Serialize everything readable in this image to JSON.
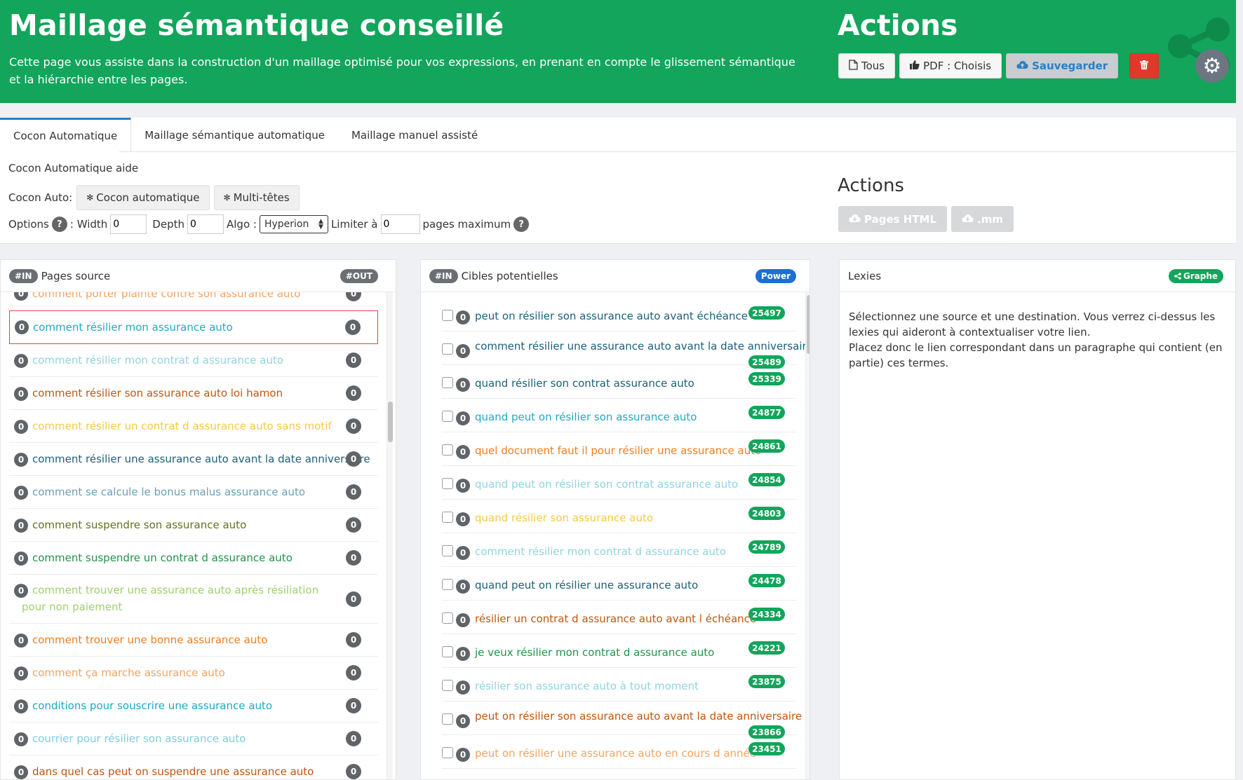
{
  "header": {
    "title": "Maillage sémantique conseillé",
    "description": "Cette page vous assiste dans la construction d'un maillage optimisé pour vos expressions, en prenant en compte le glissement sémantique et la hiérarchie entre les pages.",
    "actions_title": "Actions",
    "btn_tous": "Tous",
    "btn_pdf": "PDF : Choisis",
    "btn_save": "Sauvegarder",
    "colors": {
      "bg": "#12a55b",
      "delete": "#e0392c"
    }
  },
  "tabs": [
    {
      "label": "Cocon Automatique"
    },
    {
      "label": "Maillage sémantique automatique"
    },
    {
      "label": "Maillage manuel assisté"
    }
  ],
  "cocon": {
    "help_title": "Cocon Automatique aide",
    "label": "Cocon Auto:",
    "btn_auto": "Cocon automatique",
    "btn_multi": "Multi-têtes",
    "options_label": "Options",
    "width_label": ": Width",
    "width_value": "0",
    "depth_label": "Depth",
    "depth_value": "0",
    "algo_label": "Algo :",
    "algo_value": "Hyperion",
    "limit_label": "Limiter à",
    "limit_value": "0",
    "pages_max": "pages maximum",
    "actions_title": "Actions",
    "btn_html": "Pages HTML",
    "btn_mm": ".mm"
  },
  "sources": {
    "in_pill": "#IN",
    "title": "Pages source",
    "out_pill": "#OUT",
    "items": [
      {
        "text": "comment porter plainte contre son assurance auto",
        "count": "0",
        "out": "0",
        "color": "#f5a25d"
      },
      {
        "text": "comment résilier mon assurance auto",
        "count": "0",
        "out": "0",
        "color": "#1ea8c8"
      },
      {
        "text": "comment résilier mon contrat d assurance auto",
        "count": "0",
        "out": "0",
        "color": "#8fd3e0"
      },
      {
        "text": "comment résilier son assurance auto loi hamon",
        "count": "0",
        "out": "0",
        "color": "#c0560f"
      },
      {
        "text": "comment résilier un contrat d assurance auto sans motif",
        "count": "0",
        "out": "0",
        "color": "#f6c945"
      },
      {
        "text": "comment résilier une assurance auto avant la date anniversaire",
        "count": "0",
        "out": "0",
        "color": "#1a5f7a"
      },
      {
        "text": "comment se calcule le bonus malus assurance auto",
        "count": "0",
        "out": "0",
        "color": "#6aa0b2"
      },
      {
        "text": "comment suspendre son assurance auto",
        "count": "0",
        "out": "0",
        "color": "#66701f"
      },
      {
        "text": "comment suspendre un contrat d assurance auto",
        "count": "0",
        "out": "0",
        "color": "#209348"
      },
      {
        "text": "comment trouver une assurance auto après résiliation pour non paiement",
        "count": "0",
        "out": "0",
        "color": "#9fcf6e"
      },
      {
        "text": "comment trouver une bonne assurance auto",
        "count": "0",
        "out": "0",
        "color": "#f07d20"
      },
      {
        "text": "comment ça marche assurance auto",
        "count": "0",
        "out": "0",
        "color": "#f5a25d"
      },
      {
        "text": "conditions pour souscrire une assurance auto",
        "count": "0",
        "out": "0",
        "color": "#1ea8c8"
      },
      {
        "text": "courrier pour résilier son assurance auto",
        "count": "0",
        "out": "0",
        "color": "#7fcbdc"
      },
      {
        "text": "dans quel cas peut on suspendre une assurance auto",
        "count": "0",
        "out": "0",
        "color": "#c0560f"
      }
    ]
  },
  "targets": {
    "in_pill": "#IN",
    "title": "Cibles potentielles",
    "power_pill": "Power",
    "items": [
      {
        "text": "peut on résilier son assurance auto avant échéance",
        "count": "0",
        "power": "25497",
        "color": "#1a5f7a"
      },
      {
        "text": "comment résilier une assurance auto avant la date anniversaire",
        "count": "0",
        "power": "25489",
        "color": "#1a5f7a"
      },
      {
        "text": "quand résilier son contrat assurance auto",
        "count": "0",
        "power": "25339",
        "color": "#1a5f7a"
      },
      {
        "text": "quand peut on résilier son assurance auto",
        "count": "0",
        "power": "24877",
        "color": "#1ea8c8"
      },
      {
        "text": "quel document faut il pour résilier une assurance auto",
        "count": "0",
        "power": "24861",
        "color": "#f07d20"
      },
      {
        "text": "quand peut on résilier son contrat assurance auto",
        "count": "0",
        "power": "24854",
        "color": "#8fd3e0"
      },
      {
        "text": "quand résilier son assurance auto",
        "count": "0",
        "power": "24803",
        "color": "#f6c945"
      },
      {
        "text": "comment résilier mon contrat d assurance auto",
        "count": "0",
        "power": "24789",
        "color": "#8fd3e0"
      },
      {
        "text": "quand peut on résilier une assurance auto",
        "count": "0",
        "power": "24478",
        "color": "#1a5f7a"
      },
      {
        "text": "résilier un contrat d assurance auto avant l échéance",
        "count": "0",
        "power": "24334",
        "color": "#c0560f"
      },
      {
        "text": "je veux résilier mon contrat d assurance auto",
        "count": "0",
        "power": "24221",
        "color": "#209348"
      },
      {
        "text": "résilier son assurance auto à tout moment",
        "count": "0",
        "power": "23875",
        "color": "#8fd3e0"
      },
      {
        "text": "peut on résilier son assurance auto avant la date anniversaire",
        "count": "0",
        "power": "23866",
        "color": "#c0560f"
      },
      {
        "text": "peut on résilier une assurance auto en cours d année",
        "count": "0",
        "power": "23451",
        "color": "#f5a25d"
      }
    ]
  },
  "lexies": {
    "title": "Lexies",
    "graphe_pill": "Graphe",
    "text1": "Sélectionnez une source et une destination. Vous verrez ci-dessus les lexies qui aideront à contextualiser votre lien.",
    "text2": "Placez donc le lien correspondant dans un paragraphe qui contient (en partie) ces termes."
  }
}
